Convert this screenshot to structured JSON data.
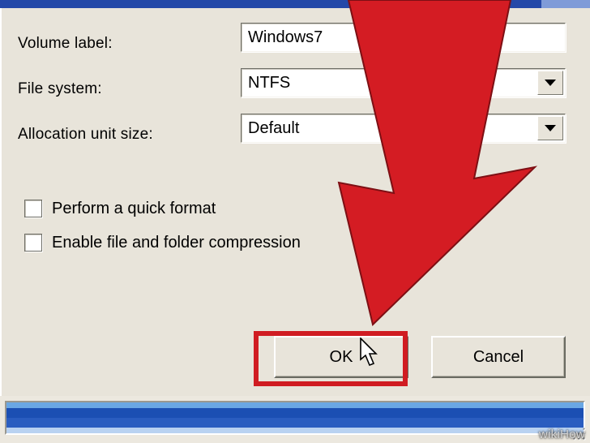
{
  "labels": {
    "volume": "Volume label:",
    "filesystem": "File system:",
    "allocation": "Allocation unit size:"
  },
  "fields": {
    "volume": "Windows7",
    "filesystem": "NTFS",
    "allocation": "Default"
  },
  "checks": {
    "quick_format": "Perform a quick format",
    "compression": "Enable file and folder compression"
  },
  "buttons": {
    "ok": "OK",
    "cancel": "Cancel"
  },
  "annotation": {
    "arrow_color": "#d41c23",
    "highlight_color": "#d01c22"
  },
  "watermark": "wikiHow"
}
